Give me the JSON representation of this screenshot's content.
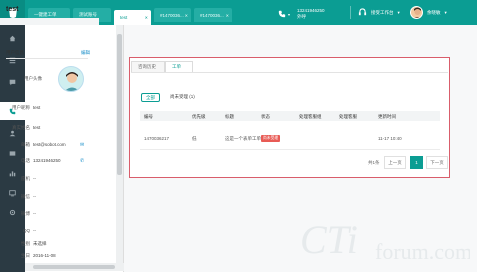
{
  "topbar": {
    "tabs": [
      {
        "label": "一键建工单"
      },
      {
        "label": "测试账号"
      },
      {
        "label": "test"
      },
      {
        "label": "#1470036..."
      },
      {
        "label": "#1470036..."
      }
    ],
    "phone_number": "13241946250",
    "phone_label": "外呼",
    "status_label": "接受工作台",
    "user_name": "余晓敏"
  },
  "customer": {
    "title": "test",
    "section_title": "用户信息",
    "edit_label": "编辑",
    "avatar_label": "用户头像",
    "fields": [
      {
        "label": "用户昵称",
        "value": "test"
      },
      {
        "label": "真实姓名",
        "value": "test"
      },
      {
        "label": "邮箱",
        "value": "test@sobot.com"
      },
      {
        "label": "电话",
        "value": "13241946250"
      },
      {
        "label": "座机",
        "value": "--"
      },
      {
        "label": "微信",
        "value": "--"
      },
      {
        "label": "微博",
        "value": "--"
      },
      {
        "label": "QQ",
        "value": "--"
      },
      {
        "label": "性别",
        "value": "未选择"
      },
      {
        "label": "生日",
        "value": "2016-11-08"
      }
    ]
  },
  "content": {
    "tabs": [
      {
        "label": "咨询历史"
      },
      {
        "label": "工单"
      }
    ],
    "filters": {
      "all": "全部",
      "related": "尚未受理 (1)"
    },
    "table": {
      "headers": [
        "编号",
        "优先级",
        "标题",
        "状态",
        "处理客服组",
        "处理客服",
        "更新时间"
      ],
      "rows": [
        {
          "id": "1470036217",
          "priority": "低",
          "title": "这是一个表单工单",
          "status": "尚未受理",
          "group": "",
          "agent": "",
          "updated": "11-17 10:40"
        }
      ]
    },
    "pagination": {
      "total": "共1条",
      "prev": "上一页",
      "current": "1",
      "next": "下一页"
    }
  },
  "watermark": {
    "main": "CTi",
    "sub": "forum.com"
  },
  "colors": {
    "brand": "#0b9d93",
    "status_red": "#e85b55",
    "highlight_border": "#d95d6b"
  }
}
